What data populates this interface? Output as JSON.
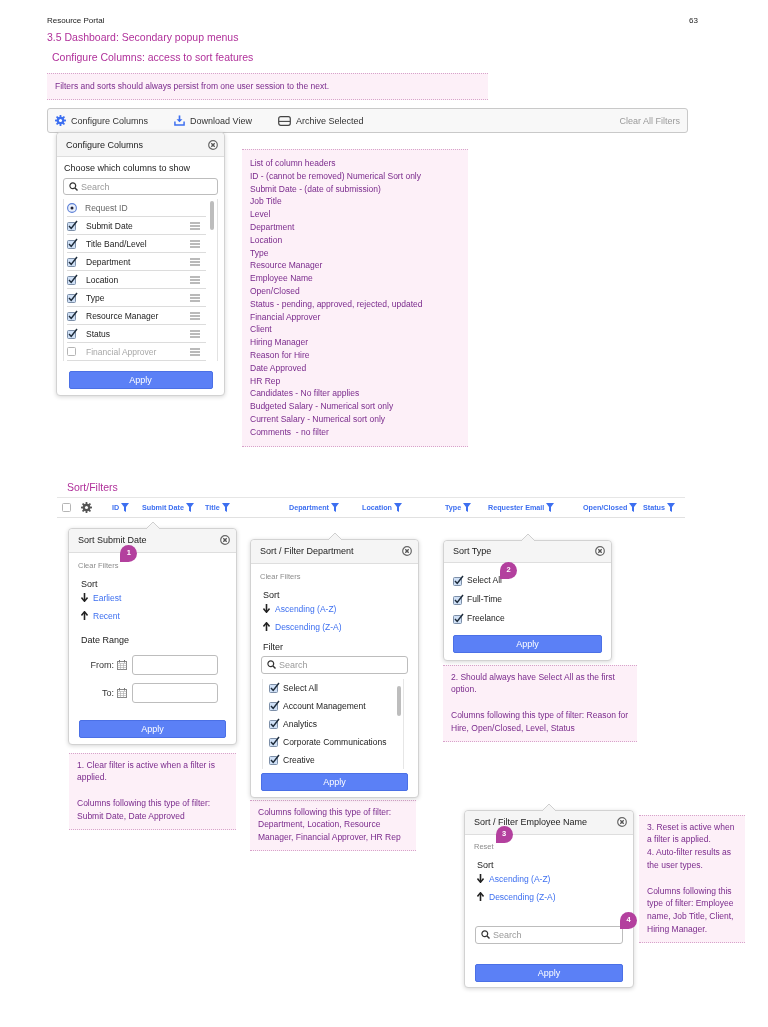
{
  "page_header": {
    "title": "Resource Portal",
    "page_number": "63"
  },
  "section_title": "3.5 Dashboard: Secondary popup menus",
  "configure": {
    "heading": "Configure Columns: access to sort features",
    "note": "Filters and sorts should always persist from one user session to the next.",
    "toolbar": {
      "actions": [
        {
          "label": "Configure Columns"
        },
        {
          "label": "Download View"
        },
        {
          "label": "Archive Selected"
        }
      ],
      "clear_all": {
        "label": "Clear All Filters",
        "disabled": true
      }
    },
    "popup": {
      "title": "Configure Columns",
      "prompt": "Choose which columns to show",
      "search": {
        "placeholder": "Search"
      },
      "columns": [
        {
          "label": "Request ID",
          "kind": "radio",
          "checked": true
        },
        {
          "label": "Submit Date",
          "kind": "checkbox",
          "checked": true
        },
        {
          "label": "Title Band/Level",
          "kind": "checkbox",
          "checked": true
        },
        {
          "label": "Department",
          "kind": "checkbox",
          "checked": true
        },
        {
          "label": "Location",
          "kind": "checkbox",
          "checked": true
        },
        {
          "label": "Type",
          "kind": "checkbox",
          "checked": true
        },
        {
          "label": "Resource Manager",
          "kind": "checkbox",
          "checked": true
        },
        {
          "label": "Status",
          "kind": "checkbox",
          "checked": true
        },
        {
          "label": "Financial Approver",
          "kind": "checkbox",
          "checked": false
        }
      ],
      "apply": "Apply"
    },
    "column_notes": [
      "List of column headers",
      "ID - (cannot be removed) Numerical Sort only",
      "Submit Date - (date of submission)",
      "Job Title",
      "Level",
      "Department",
      "Location",
      "Type",
      "Resource Manager",
      "Employee Name",
      "Open/Closed",
      "Status - pending, approved, rejected, updated",
      "Financial Approver",
      "Client",
      "Hiring Manager",
      "Reason for Hire",
      "Date Approved",
      "HR Rep",
      "Candidates - No filter applies",
      "Budgeted Salary - Numerical sort only",
      "Current Salary - Numerical sort only",
      "Comments  - no filter"
    ]
  },
  "sort_filters": {
    "heading": "Sort/Filters",
    "table_header": {
      "checkbox": {
        "checked": false
      },
      "columns": [
        "ID",
        "Submit Date",
        "Title",
        "Department",
        "Location",
        "Type",
        "Requester Email",
        "Open/Closed",
        "Status"
      ]
    },
    "popups": [
      {
        "kind": "date",
        "title": "Sort Submit Date",
        "clear": {
          "label": "Clear Filters",
          "disabled": true,
          "marker": "1"
        },
        "sort": {
          "label": "Sort",
          "options": [
            "Earliest",
            "Recent"
          ]
        },
        "date_range": {
          "label": "Date Range",
          "fields": [
            {
              "label": "From:"
            },
            {
              "label": "To:"
            }
          ]
        },
        "apply": "Apply",
        "note": [
          [
            "1. Clear filter is active when a filter is applied."
          ],
          [
            "Columns following this type of filter: Submit Date, Date Approved"
          ]
        ]
      },
      {
        "kind": "list",
        "title": "Sort / Filter Department",
        "clear": {
          "label": "Clear Filters",
          "disabled": true
        },
        "sort": {
          "label": "Sort",
          "options": [
            "Ascending (A-Z)",
            "Descending (Z-A)"
          ]
        },
        "filter": {
          "label": "Filter",
          "search": {
            "placeholder": "Search"
          },
          "options": [
            {
              "label": "Select All",
              "checked": true
            },
            {
              "label": "Account Management",
              "checked": true
            },
            {
              "label": "Analytics",
              "checked": true
            },
            {
              "label": "Corporate Communications",
              "checked": true
            },
            {
              "label": "Creative",
              "checked": true
            }
          ]
        },
        "apply": "Apply",
        "note": [
          [
            "Columns following this type of filter: Department, Location, Resource Manager, Financial Approver, HR Rep"
          ]
        ]
      },
      {
        "kind": "checklist",
        "title": "Sort Type",
        "options": [
          {
            "label": "Select All",
            "checked": true,
            "marker": "2"
          },
          {
            "label": "Full-Time",
            "checked": true
          },
          {
            "label": "Freelance",
            "checked": true
          }
        ],
        "apply": "Apply",
        "note": [
          [
            "2. Should always have Select All as the first option."
          ],
          [
            "Columns following this type of filter: Reason for Hire, Open/Closed, Level, Status"
          ]
        ]
      },
      {
        "kind": "search",
        "title": "Sort / Filter Employee Name",
        "clear": {
          "label": "Reset",
          "disabled": true,
          "marker": "3"
        },
        "sort": {
          "label": "Sort",
          "options": [
            "Ascending (A-Z)",
            "Descending (Z-A)"
          ]
        },
        "search": {
          "placeholder": "Search",
          "marker": "4"
        },
        "apply": "Apply",
        "note": [
          [
            "3. Reset is active when a filter is applied.",
            "4. Auto-filter results as the user types."
          ],
          [
            "Columns following this type of filter: Employee name, Job Title, Client, Hiring Manager."
          ]
        ]
      }
    ]
  }
}
